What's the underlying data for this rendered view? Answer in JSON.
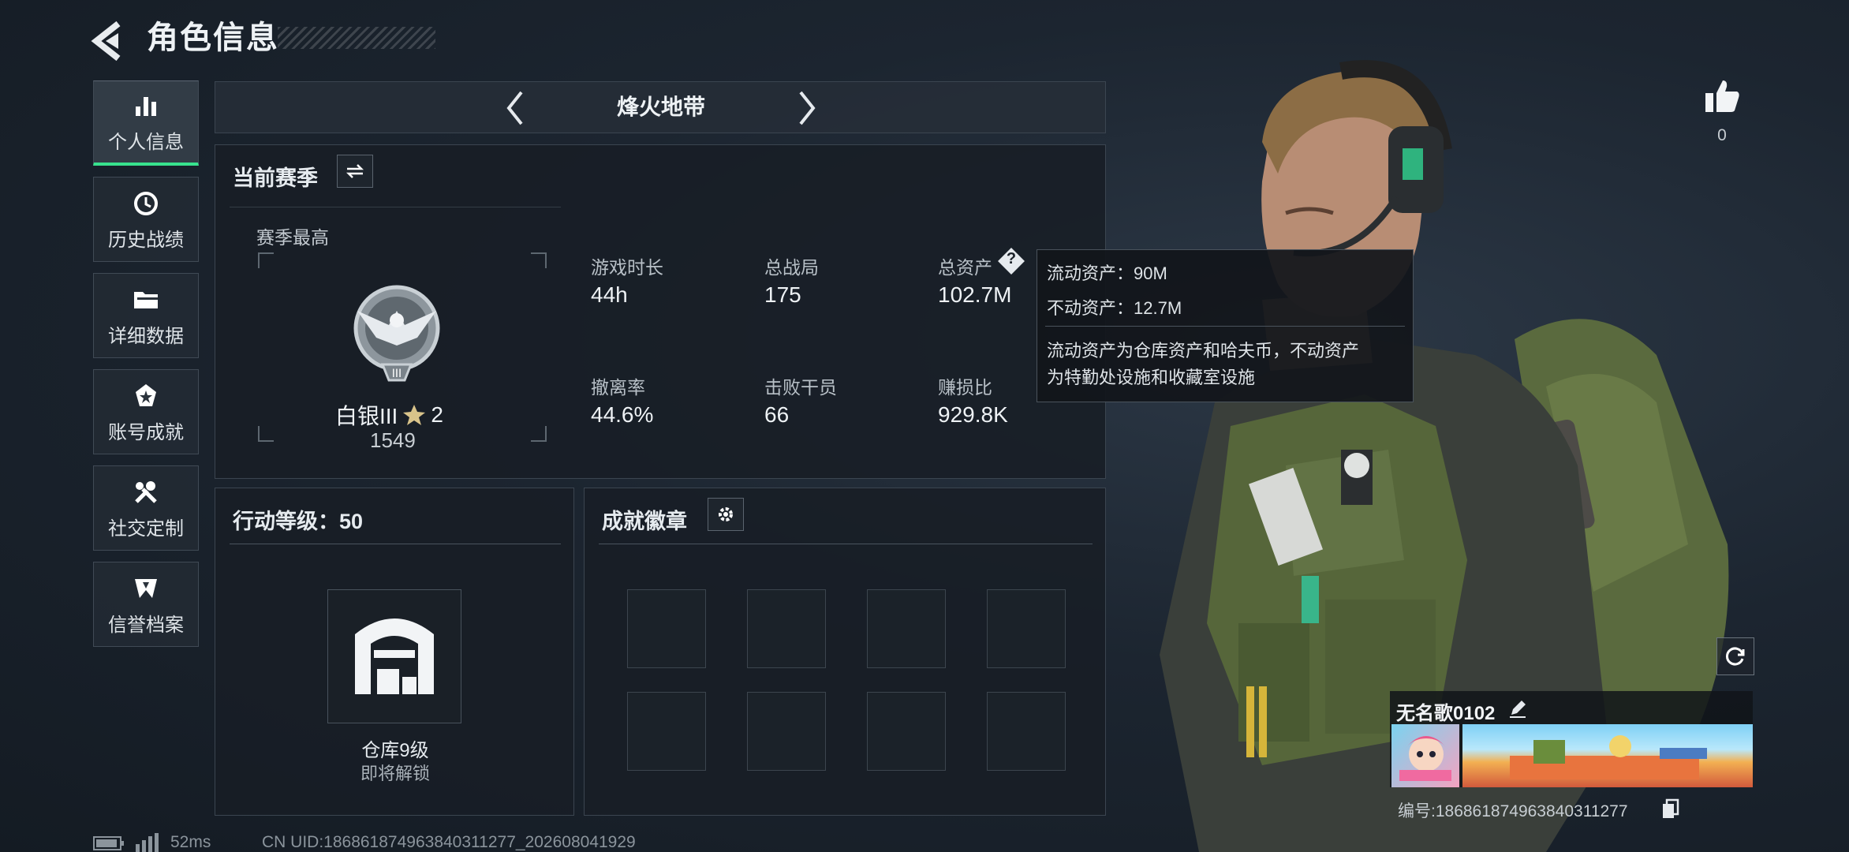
{
  "header": {
    "title": "角色信息"
  },
  "nav": {
    "items": [
      {
        "label": "个人信息",
        "icon": "bar-chart-icon"
      },
      {
        "label": "历史战绩",
        "icon": "history-icon"
      },
      {
        "label": "详细数据",
        "icon": "folder-icon"
      },
      {
        "label": "账号成就",
        "icon": "achievement-icon"
      },
      {
        "label": "社交定制",
        "icon": "tools-icon"
      },
      {
        "label": "信誉档案",
        "icon": "reputation-icon"
      }
    ]
  },
  "mode": {
    "title": "烽火地带"
  },
  "season": {
    "title": "当前赛季",
    "best_label": "赛季最高",
    "rank_name": "白银III",
    "rank_stars": "2",
    "rank_score": "1549",
    "rank_numeral": "III"
  },
  "stats": {
    "playtime": {
      "label": "游戏时长",
      "value": "44h"
    },
    "matches": {
      "label": "总战局",
      "value": "175"
    },
    "assets": {
      "label": "总资产",
      "value": "102.7M"
    },
    "extract_rate": {
      "label": "撤离率",
      "value": "44.6%"
    },
    "kills": {
      "label": "击败干员",
      "value": "66"
    },
    "profit_ratio": {
      "label": "赚损比",
      "value": "929.8K"
    }
  },
  "tooltip": {
    "liquid": "流动资产：90M",
    "fixed": "不动资产：12.7M",
    "desc1": "流动资产为仓库资产和哈夫币，不动资产",
    "desc2": "为特勤处设施和收藏室设施"
  },
  "action_level": {
    "title": "行动等级：50",
    "warehouse_label": "仓库9级",
    "warehouse_sub": "即将解锁"
  },
  "badges": {
    "title": "成就徽章"
  },
  "profile": {
    "likes": "0",
    "name": "无名歌0102",
    "id_text": "编号:18686187496384031127​7"
  },
  "footer": {
    "ping": "52ms",
    "uid": "CN UID:18686187496384031127​7_202608041929"
  },
  "colors": {
    "accent": "#38e28e",
    "panel": "#181e26",
    "text": "#eef2f5"
  }
}
